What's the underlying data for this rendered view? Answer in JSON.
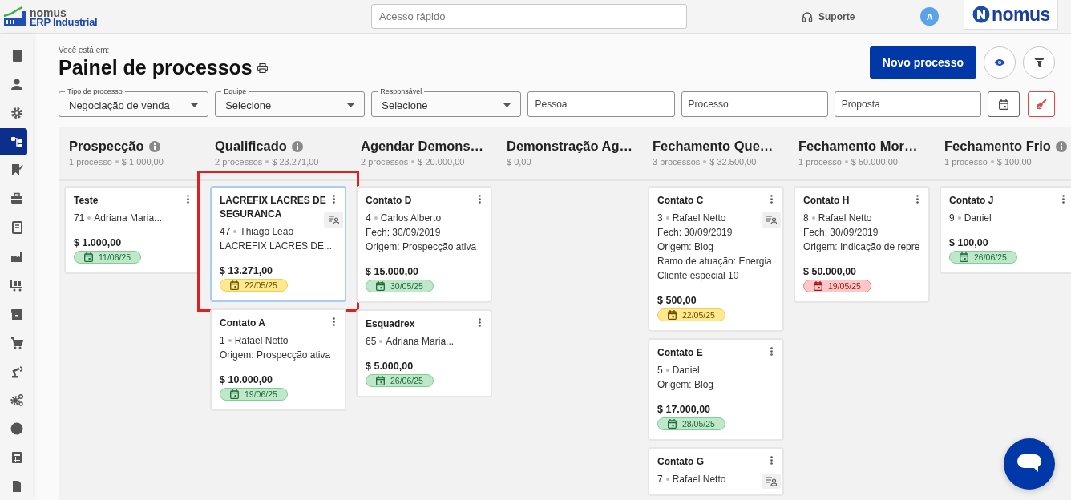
{
  "app": {
    "brand": "nomus",
    "product": "ERP Industrial"
  },
  "top_bar": {
    "search": {
      "placeholder": "Acesso rápido"
    },
    "support": "Suporte",
    "avatar": "A",
    "logo": "nomus"
  },
  "sidebar": {
    "items": [
      {
        "selected": false
      },
      {
        "selected": false
      },
      {
        "selected": false
      },
      {
        "selected": true
      },
      {
        "selected": false
      },
      {
        "selected": false
      },
      {
        "selected": false
      },
      {
        "selected": false
      },
      {
        "selected": false
      },
      {
        "selected": false
      },
      {
        "selected": false
      },
      {
        "selected": false
      },
      {
        "selected": false
      },
      {
        "selected": false
      },
      {
        "selected": false
      },
      {
        "selected": false
      }
    ]
  },
  "page": {
    "breadcrumb": "Você está em:",
    "title": "Painel de processos",
    "new_button": "Novo processo"
  },
  "filters": [
    {
      "kind": "select",
      "label": "Tipo de processo",
      "value": "Negociação de venda"
    },
    {
      "kind": "select",
      "label": "Equipe",
      "value": "Selecione"
    },
    {
      "kind": "select",
      "label": "Responsável",
      "value": "Selecione"
    },
    {
      "kind": "text",
      "placeholder": "Pessoa"
    },
    {
      "kind": "text",
      "placeholder": "Processo"
    },
    {
      "kind": "text",
      "placeholder": "Proposta"
    }
  ],
  "board": {
    "columns": [
      {
        "title": "Prospecção",
        "info": true,
        "count": "1 processo",
        "total": "$ 1.000,00",
        "cards": [
          {
            "title": "Teste",
            "ref": "71",
            "owner": "Adriana Maria...",
            "amount": "$ 1.000,00",
            "date": "11/06/25",
            "color": "#bfe8cb",
            "owner_icon": false,
            "highlighted": false
          }
        ]
      },
      {
        "title": "Qualificado",
        "info": true,
        "count": "2 processos",
        "total": "$ 23.271,00",
        "cards": [
          {
            "title": "LACREFIX LACRES DE SEGURANCA",
            "ref": "47",
            "owner": "Thiago Leão",
            "lines": [
              "LACREFIX LACRES DE..."
            ],
            "amount": "$ 13.271,00",
            "date": "22/05/25",
            "color": "#ffe98f",
            "owner_icon": true,
            "highlighted": true
          },
          {
            "title": "Contato A",
            "ref": "1",
            "owner": "Rafael Netto",
            "lines": [
              "Origem: Prospecção ativa"
            ],
            "amount": "$ 10.000,00",
            "date": "19/06/25",
            "color": "#bfe8cb",
            "owner_icon": false,
            "highlighted": false
          }
        ]
      },
      {
        "title": "Agendar Demons…",
        "info": false,
        "count": "2 processos",
        "total": "$ 20.000,00",
        "cards": [
          {
            "title": "Contato D",
            "ref": "4",
            "owner": "Carlos Alberto",
            "lines": [
              "Fech: 30/09/2019",
              "Origem: Prospecção ativa"
            ],
            "amount": "$ 15.000,00",
            "date": "30/05/25",
            "color": "#bfe8cb",
            "owner_icon": false,
            "highlighted": false
          },
          {
            "title": "Esquadrex",
            "ref": "65",
            "owner": "Adriana Maria...",
            "amount": "$ 5.000,00",
            "date": "26/06/25",
            "color": "#bfe8cb",
            "owner_icon": false,
            "highlighted": false
          }
        ]
      },
      {
        "title": "Demonstração Ag…",
        "info": false,
        "total": "$ 0,00"
      },
      {
        "title": "Fechamento Que…",
        "info": false,
        "count": "3 processos",
        "total": "$ 32.500,00",
        "cards": [
          {
            "title": "Contato C",
            "ref": "3",
            "owner": "Rafael Netto",
            "lines": [
              "Fech: 30/09/2019",
              "Origem: Blog",
              "Ramo de atuação: Energia",
              "Cliente especial 10"
            ],
            "amount": "$ 500,00",
            "date": "22/05/25",
            "color": "#ffe98f",
            "owner_icon": true,
            "highlighted": false
          },
          {
            "title": "Contato E",
            "ref": "5",
            "owner": "Daniel",
            "lines": [
              "Origem: Blog"
            ],
            "amount": "$ 17.000,00",
            "date": "28/05/25",
            "color": "#bfe8cb",
            "owner_icon": false,
            "highlighted": false
          },
          {
            "title": "Contato G",
            "ref": "7",
            "owner": "Rafael Netto",
            "owner_icon": true,
            "highlighted": false
          }
        ]
      },
      {
        "title": "Fechamento Mor…",
        "info": false,
        "count": "1 processo",
        "total": "$ 50.000,00",
        "cards": [
          {
            "title": "Contato H",
            "ref": "8",
            "owner": "Rafael Netto",
            "lines": [
              "Fech: 30/09/2019",
              "Origem: Indicação de repre"
            ],
            "amount": "$ 50.000,00",
            "date": "19/05/25",
            "color": "#ffc8c8",
            "owner_icon": false,
            "highlighted": false
          }
        ]
      },
      {
        "title": "Fechamento Frio",
        "info": true,
        "count": "1 processo",
        "total": "$ 100,00",
        "cards": [
          {
            "title": "Contato J",
            "ref": "9",
            "owner": "Daniel",
            "amount": "$ 100,00",
            "date": "26/06/25",
            "color": "#bfe8cb",
            "owner_icon": false,
            "highlighted": false
          }
        ]
      }
    ]
  }
}
